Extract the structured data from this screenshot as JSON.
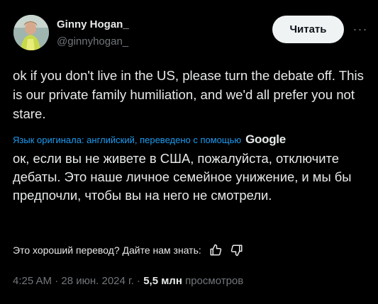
{
  "author": {
    "name": "Ginny Hogan_",
    "handle": "@ginnyhogan_"
  },
  "follow_button": "Читать",
  "tweet_text": "ok if you don't live in the US, please turn the debate off. This is our private family humiliation, and we'd all prefer you not stare.",
  "translation": {
    "note": "Язык оригинала: английский, переведено с помощью",
    "provider": "Google",
    "text": "ок, если вы не живете в США, пожалуйста, отключите дебаты. Это наше личное семейное унижение, и мы бы предпочли, чтобы вы на него не смотрели."
  },
  "feedback_prompt": "Это хороший перевод? Дайте нам знать:",
  "meta": {
    "time": "4:25 AM",
    "separator": "·",
    "date": "28 июн. 2024 г.",
    "views_count": "5,5 млн",
    "views_label": "просмотров"
  },
  "colors": {
    "background": "#000000",
    "text": "#e7e9ea",
    "muted": "#71767b",
    "link": "#1d9bf0"
  }
}
